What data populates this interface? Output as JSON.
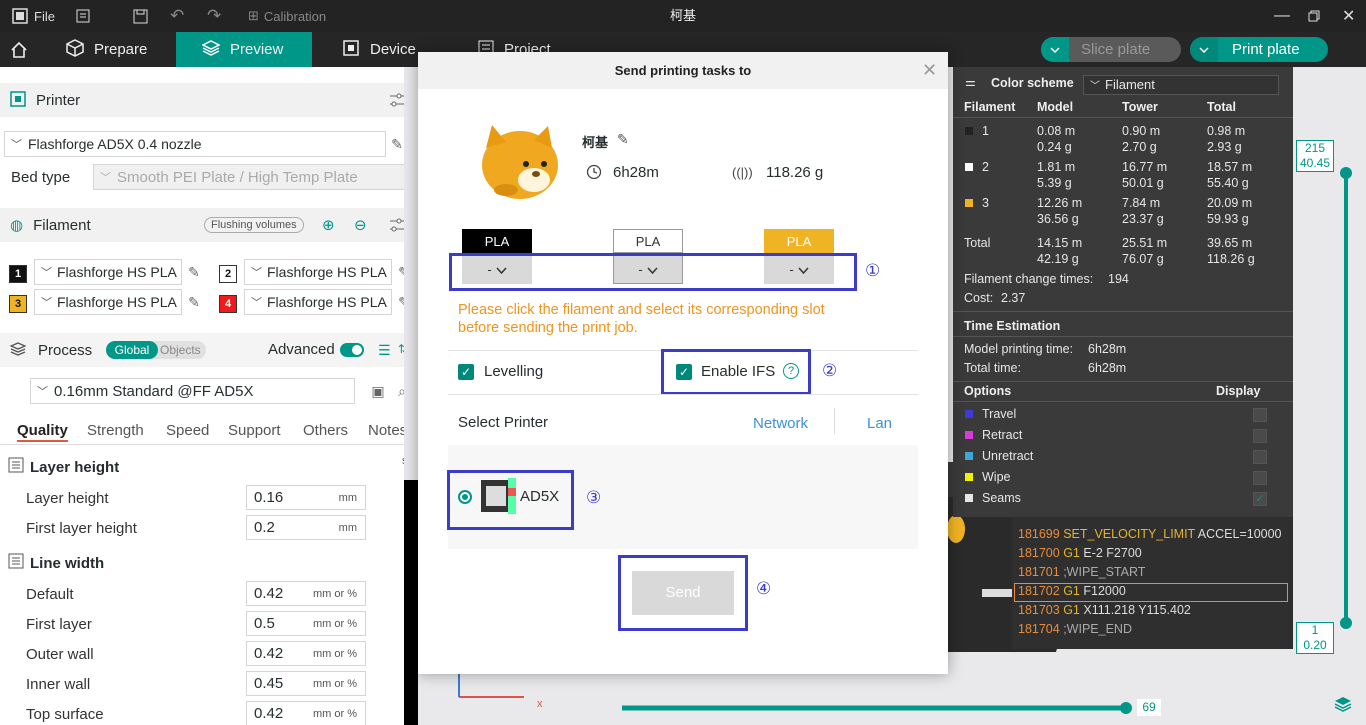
{
  "titlebar": {
    "file_label": "File",
    "calibration_label": "Calibration",
    "window_title": "柯基"
  },
  "tabs": {
    "prepare": "Prepare",
    "preview": "Preview",
    "device": "Device",
    "project": "Project",
    "slice_plate": "Slice plate",
    "print_plate": "Print plate"
  },
  "left": {
    "printer_title": "Printer",
    "printer_value": "Flashforge AD5X 0.4 nozzle",
    "bed_type_label": "Bed type",
    "bed_type_value": "Smooth PEI Plate / High Temp Plate",
    "filament_title": "Filament",
    "flushing_label": "Flushing volumes",
    "filaments": [
      {
        "num": "1",
        "name": "Flashforge HS PLA",
        "color": "#111111",
        "text": "#ffffff"
      },
      {
        "num": "2",
        "name": "Flashforge HS PLA",
        "color": "#ffffff",
        "text": "#111111"
      },
      {
        "num": "3",
        "name": "Flashforge HS PLA",
        "color": "#f0b323",
        "text": "#111111"
      },
      {
        "num": "4",
        "name": "Flashforge HS PLA",
        "color": "#ee1c1c",
        "text": "#ffffff"
      }
    ],
    "process_title": "Process",
    "global_label": "Global",
    "objects_label": "Objects",
    "advanced_label": "Advanced",
    "process_value": "0.16mm Standard @FF AD5X",
    "subtabs": [
      "Quality",
      "Strength",
      "Speed",
      "Support",
      "Others",
      "Notes"
    ],
    "layer_height_group": "Layer height",
    "line_width_group": "Line width",
    "rows": [
      {
        "label": "Layer height",
        "value": "0.16",
        "unit": "mm"
      },
      {
        "label": "First layer height",
        "value": "0.2",
        "unit": "mm"
      },
      {
        "label": "Default",
        "value": "0.42",
        "unit": "mm or %"
      },
      {
        "label": "First layer",
        "value": "0.5",
        "unit": "mm or %"
      },
      {
        "label": "Outer wall",
        "value": "0.42",
        "unit": "mm or %"
      },
      {
        "label": "Inner wall",
        "value": "0.45",
        "unit": "mm or %"
      },
      {
        "label": "Top surface",
        "value": "0.42",
        "unit": "mm or %"
      }
    ]
  },
  "legend": {
    "color_scheme_label": "Color scheme",
    "color_scheme_value": "Filament",
    "headers": [
      "Filament",
      "Model",
      "Tower",
      "Total"
    ],
    "rows": [
      {
        "id": "1",
        "color": "#222222",
        "model": [
          "0.08 m",
          "0.24 g"
        ],
        "tower": [
          "0.90 m",
          "2.70 g"
        ],
        "total": [
          "0.98 m",
          "2.93 g"
        ]
      },
      {
        "id": "2",
        "color": "#ffffff",
        "model": [
          "1.81 m",
          "5.39 g"
        ],
        "tower": [
          "16.77 m",
          "50.01 g"
        ],
        "total": [
          "18.57 m",
          "55.40 g"
        ]
      },
      {
        "id": "3",
        "color": "#f0b323",
        "model": [
          "12.26 m",
          "36.56 g"
        ],
        "tower": [
          "7.84 m",
          "23.37 g"
        ],
        "total": [
          "20.09 m",
          "59.93 g"
        ]
      }
    ],
    "total_label": "Total",
    "total_model": [
      "14.15 m",
      "42.19 g"
    ],
    "total_tower": [
      "25.51 m",
      "76.07 g"
    ],
    "total_total": [
      "39.65 m",
      "118.26 g"
    ],
    "filament_change_label": "Filament change times:",
    "filament_change_value": "194",
    "cost_label": "Cost:",
    "cost_value": "2.37",
    "time_title": "Time Estimation",
    "model_time_label": "Model printing time:",
    "model_time_value": "6h28m",
    "total_time_label": "Total time:",
    "total_time_value": "6h28m",
    "options_label": "Options",
    "display_label": "Display",
    "options": [
      {
        "name": "Travel",
        "color": "#3b3bd6",
        "checked": false
      },
      {
        "name": "Retract",
        "color": "#d63bd6",
        "checked": false
      },
      {
        "name": "Unretract",
        "color": "#3ba6d6",
        "checked": false
      },
      {
        "name": "Wipe",
        "color": "#f0f000",
        "checked": false
      },
      {
        "name": "Seams",
        "color": "#e6e6e6",
        "checked": true
      }
    ]
  },
  "gcode": [
    {
      "num": "181699",
      "cmd": "SET_VELOCITY_LIMIT",
      "args": "ACCEL=10000"
    },
    {
      "num": "181700",
      "cmd": "G1",
      "args": "E-2 F2700"
    },
    {
      "num": "181701",
      "cmd": "",
      "args": ";WIPE_START"
    },
    {
      "num": "181702",
      "cmd": "G1",
      "args": "F12000"
    },
    {
      "num": "181703",
      "cmd": "G1",
      "args": "X111.218 Y115.402"
    },
    {
      "num": "181704",
      "cmd": "",
      "args": ";WIPE_END"
    }
  ],
  "slider": {
    "top_layer": "215",
    "top_height": "40.45",
    "bottom_layer": "1",
    "bottom_height": "0.20",
    "horizontal_value": "69"
  },
  "dialog": {
    "title": "Send printing tasks to",
    "model_name": "柯基",
    "time": "6h28m",
    "weight": "118.26 g",
    "filament_slots": [
      {
        "type": "PLA",
        "bg": "#000000",
        "fg": "#ffffff",
        "slot": "-"
      },
      {
        "type": "PLA",
        "bg": "#ffffff",
        "fg": "#333333",
        "slot": "-"
      },
      {
        "type": "PLA",
        "bg": "#f0b323",
        "fg": "#ffffff",
        "slot": "-"
      }
    ],
    "warning": [
      "Please click the filament and select its corresponding slot",
      "before sending the print job."
    ],
    "levelling_label": "Levelling",
    "ifs_label": "Enable IFS",
    "select_printer_label": "Select Printer",
    "network_label": "Network",
    "lan_label": "Lan",
    "printer_name": "AD5X",
    "send_label": "Send",
    "annotations": [
      "①",
      "②",
      "③",
      "④"
    ]
  }
}
